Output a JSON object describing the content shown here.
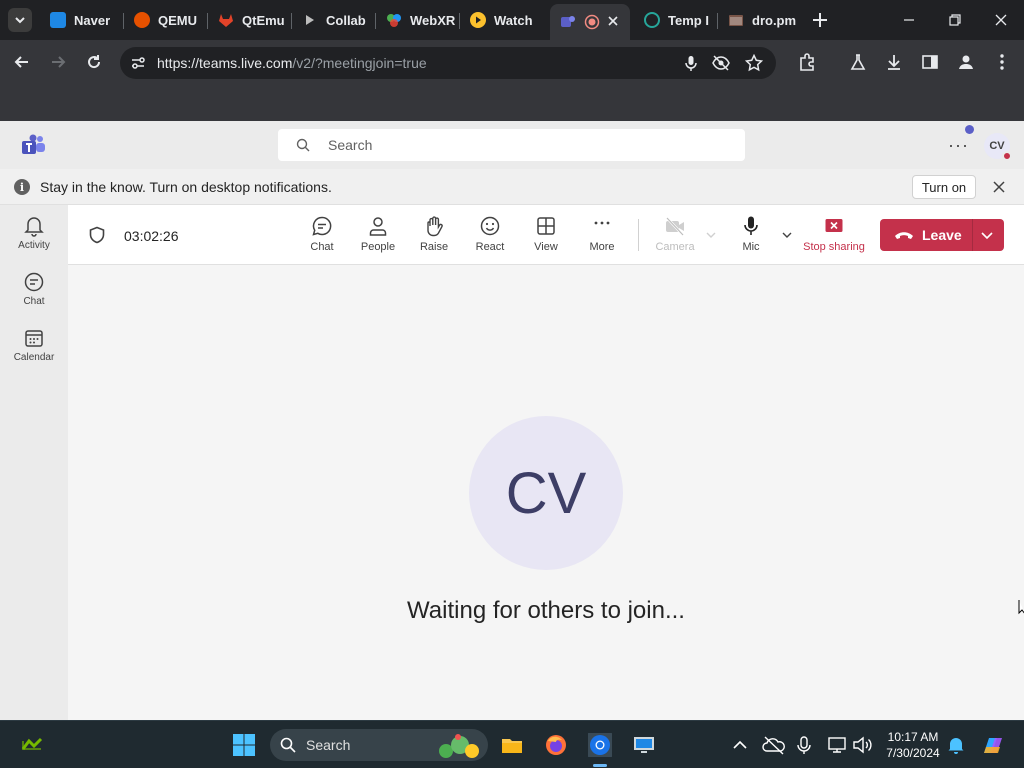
{
  "browser": {
    "tabs": [
      {
        "label": "Naver",
        "color": "#1e88e5"
      },
      {
        "label": "QEMU",
        "color": "#e65100"
      },
      {
        "label": "QtEmu",
        "color": "#e24329"
      },
      {
        "label": "Collab",
        "color": "#9e9e9e"
      },
      {
        "label": "WebXR",
        "color": "#4caf50"
      },
      {
        "label": "Watch",
        "color": "#fbc02d"
      },
      {
        "label": "",
        "color": "#5b5fc7",
        "active": true
      },
      {
        "label": "Temp I",
        "color": "#00897b"
      },
      {
        "label": "dro.pm",
        "color": "#795548"
      }
    ],
    "url_host": "https://teams.live.com",
    "url_path": "/v2/?meetingjoin=true"
  },
  "teams": {
    "search_placeholder": "Search",
    "more": "···",
    "avatar_initials": "CV",
    "notice_text": "Stay in the know. Turn on desktop notifications.",
    "notice_button": "Turn on",
    "info_glyph": "i",
    "rail": [
      {
        "label": "Activity",
        "icon": "bell-icon"
      },
      {
        "label": "Chat",
        "icon": "chat-icon"
      },
      {
        "label": "Calendar",
        "icon": "calendar-icon"
      }
    ],
    "meeting": {
      "timer": "03:02:26",
      "controls": {
        "chat": "Chat",
        "people": "People",
        "raise": "Raise",
        "react": "React",
        "view": "View",
        "more": "More",
        "camera": "Camera",
        "mic": "Mic",
        "stop_sharing": "Stop sharing",
        "leave": "Leave"
      },
      "avatar_initials": "CV",
      "waiting_text": "Waiting for others to join..."
    },
    "colors": {
      "brand": "#5b5fc7",
      "leave": "#c4314b"
    }
  },
  "taskbar": {
    "search_label": "Search",
    "time": "10:17 AM",
    "date": "7/30/2024"
  }
}
